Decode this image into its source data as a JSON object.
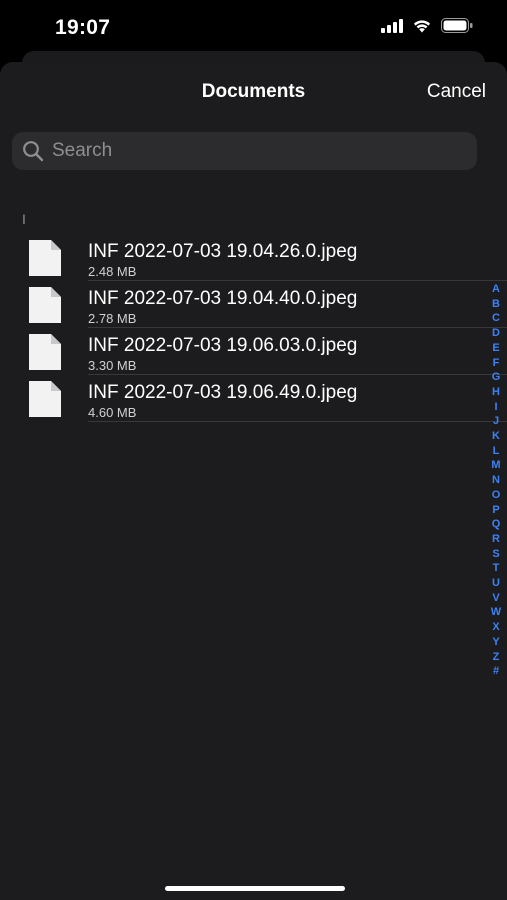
{
  "status_bar": {
    "time": "19:07",
    "icons": [
      "cellular-signal-icon",
      "wifi-icon",
      "battery-icon"
    ]
  },
  "header": {
    "title": "Documents",
    "cancel_label": "Cancel"
  },
  "search": {
    "placeholder": "Search"
  },
  "section": {
    "letter": "I"
  },
  "files": [
    {
      "name": "INF 2022-07-03 19.04.26.0.jpeg",
      "size": "2.48 MB"
    },
    {
      "name": "INF 2022-07-03 19.04.40.0.jpeg",
      "size": "2.78 MB"
    },
    {
      "name": "INF 2022-07-03 19.06.03.0.jpeg",
      "size": "3.30 MB"
    },
    {
      "name": "INF 2022-07-03 19.06.49.0.jpeg",
      "size": "4.60 MB"
    }
  ],
  "index": [
    "A",
    "B",
    "C",
    "D",
    "E",
    "F",
    "G",
    "H",
    "I",
    "J",
    "K",
    "L",
    "M",
    "N",
    "O",
    "P",
    "Q",
    "R",
    "S",
    "T",
    "U",
    "V",
    "W",
    "X",
    "Y",
    "Z",
    "#"
  ],
  "colors": {
    "background": "#1c1c1e",
    "search_field": "#2c2c2e",
    "index_accent": "#3b82f6",
    "secondary_text": "#8e8e93"
  }
}
